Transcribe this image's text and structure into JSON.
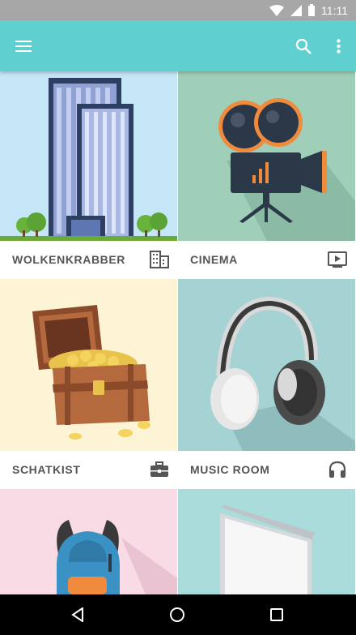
{
  "status_bar": {
    "time": "11:11",
    "icons": [
      "wifi-icon",
      "signal-icon",
      "battery-icon"
    ]
  },
  "app_bar": {
    "color": "#5fcfcf",
    "left_icon": "menu-icon",
    "right_icons": [
      "search-icon",
      "more-vert-icon"
    ]
  },
  "tiles": [
    {
      "label": "WOLKENKRABBER",
      "icon": "building-icon",
      "background": "#c4e6f7"
    },
    {
      "label": "CINEMA",
      "icon": "video-icon",
      "background": "#9fcfb8"
    },
    {
      "label": "SCHATKIST",
      "icon": "briefcase-icon",
      "background": "#fdf4d5"
    },
    {
      "label": "MUSIC ROOM",
      "icon": "headphones-icon",
      "background": "#a5d3d3"
    },
    {
      "label": "",
      "icon": "",
      "background": "#f8dbe5"
    },
    {
      "label": "",
      "icon": "",
      "background": "#a9dcda"
    }
  ],
  "nav_bar": {
    "buttons": [
      "back-icon",
      "home-icon",
      "recents-icon"
    ]
  }
}
